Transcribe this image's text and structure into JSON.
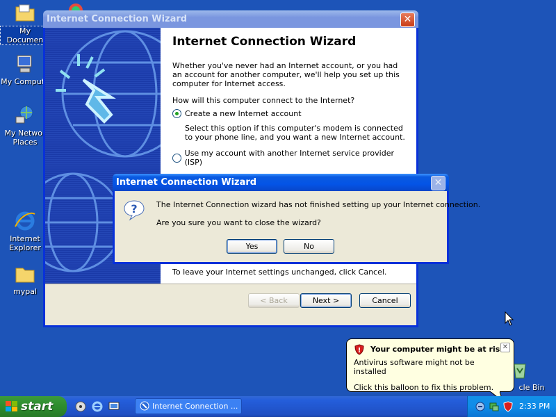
{
  "desktop": {
    "icons": [
      {
        "label": "My Documen"
      },
      {
        "label": "My Compute"
      },
      {
        "label": "My Networ Places"
      },
      {
        "label": "Internet Explorer"
      },
      {
        "label": "mypal"
      },
      {
        "label": "cle Bin"
      }
    ]
  },
  "wizard": {
    "title": "Internet Connection Wizard",
    "heading": "Internet Connection Wizard",
    "intro": "Whether you've never had an Internet account, or you had an account for another computer, we'll help you set up this computer for Internet access.",
    "question": "How will this computer connect to the Internet?",
    "option1_label": "Create a new Internet account",
    "option1_desc": "Select this option if this computer's modem is connected to your phone line, and you want a new Internet account.",
    "option2_label": "Use my account with another Internet service provider (ISP)",
    "leave_text": "To leave your Internet settings unchanged, click Cancel.",
    "back_label": "< Back",
    "next_label": "Next >",
    "cancel_label": "Cancel"
  },
  "dialog": {
    "title": "Internet Connection Wizard",
    "message": "The Internet Connection wizard has not finished setting up your Internet connection.",
    "question": "Are you sure you want to close the wizard?",
    "yes_label": "Yes",
    "no_label": "No"
  },
  "balloon": {
    "title": "Your computer might be at risk",
    "line1": "Antivirus software might not be installed",
    "line2": "Click this balloon to fix this problem."
  },
  "taskbar": {
    "start_label": "start",
    "task_label": "Internet Connection ...",
    "clock": "2:33 PM"
  }
}
